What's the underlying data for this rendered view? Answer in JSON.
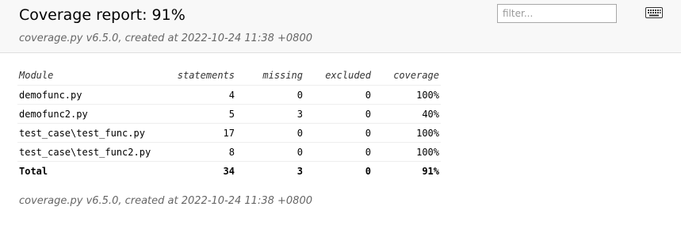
{
  "header": {
    "title": "Coverage report: 91%",
    "created": "coverage.py v6.5.0, created at 2022-10-24 11:38 +0800",
    "filter_placeholder": "filter...",
    "filter_value": ""
  },
  "icons": {
    "keyboard": "keyboard-icon"
  },
  "table": {
    "columns": [
      "Module",
      "statements",
      "missing",
      "excluded",
      "coverage"
    ],
    "rows": [
      [
        "demofunc.py",
        "4",
        "0",
        "0",
        "100%"
      ],
      [
        "demofunc2.py",
        "5",
        "3",
        "0",
        "40%"
      ],
      [
        "test_case\\test_func.py",
        "17",
        "0",
        "0",
        "100%"
      ],
      [
        "test_case\\test_func2.py",
        "8",
        "0",
        "0",
        "100%"
      ]
    ],
    "total": [
      "Total",
      "34",
      "3",
      "0",
      "91%"
    ]
  },
  "footer": {
    "created": "coverage.py v6.5.0, created at 2022-10-24 11:38 +0800"
  }
}
